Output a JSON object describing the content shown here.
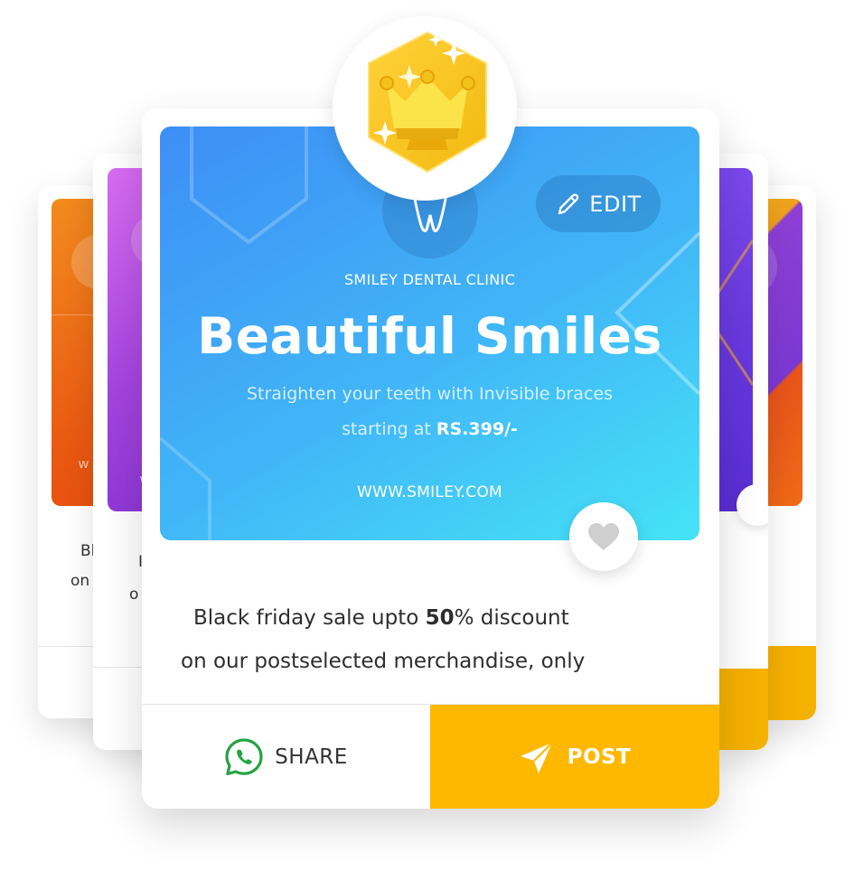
{
  "template": {
    "clinic_name": "SMILEY DENTAL CLINIC",
    "headline": "Beautiful Smiles",
    "subtitle_line1": "Straighten your teeth with Invisible braces",
    "subtitle_prefix": "starting at ",
    "price": "RS.399/-",
    "website": "WWW.SMILEY.COM",
    "edit_label": "EDIT"
  },
  "caption": {
    "line1_prefix": "Black friday sale upto ",
    "line1_bold": "50",
    "line1_suffix": "% discount",
    "line2": "on our postselected merchandise, only"
  },
  "actions": {
    "share_label": "SHARE",
    "post_label": "POST"
  },
  "back_cards": {
    "left_far": {
      "text1": "Bl",
      "text2": "on",
      "letter": "w"
    },
    "left_near": {
      "text1": "I",
      "text2": "o",
      "letter": "w"
    }
  },
  "colors": {
    "post_yellow": "#ffb800",
    "whatsapp_green": "#25a244",
    "gradient_start": "#3d8ef5",
    "gradient_end": "#45e3f6",
    "badge_gold": "#f5c518"
  }
}
